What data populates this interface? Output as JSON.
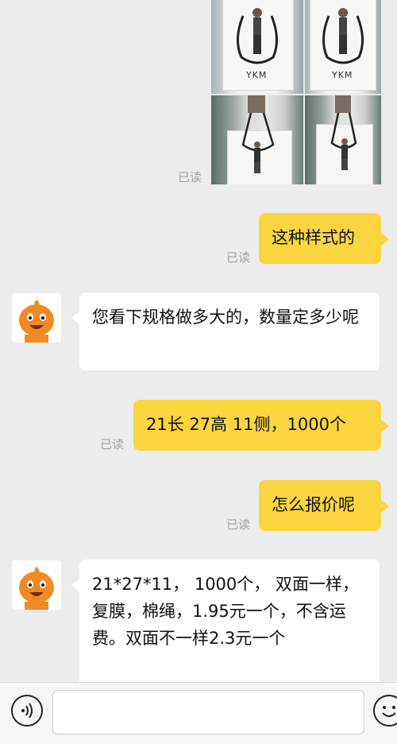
{
  "messages": {
    "read_label": "已读",
    "msg1_text": "这种样式的",
    "msg2_text": "您看下规格做多大的，数量定多少呢",
    "msg3_text": "21长  27高 11侧，1000个",
    "msg4_text": "怎么报价呢",
    "msg5_text": "21*27*11， 1000个， 双面一样，复膜，棉绳，1.95元一个，不含运费。双面不一样2.3元一个"
  },
  "images": {
    "brand_text": "YKM"
  },
  "colors": {
    "my_bubble": "#fcd53f",
    "other_bubble": "#ffffff",
    "background": "#ececec",
    "read_text": "#a3a3a3"
  },
  "icons": {
    "voice": "voice-icon",
    "emoji": "emoji-icon",
    "avatar": "orange-mascot-avatar"
  }
}
